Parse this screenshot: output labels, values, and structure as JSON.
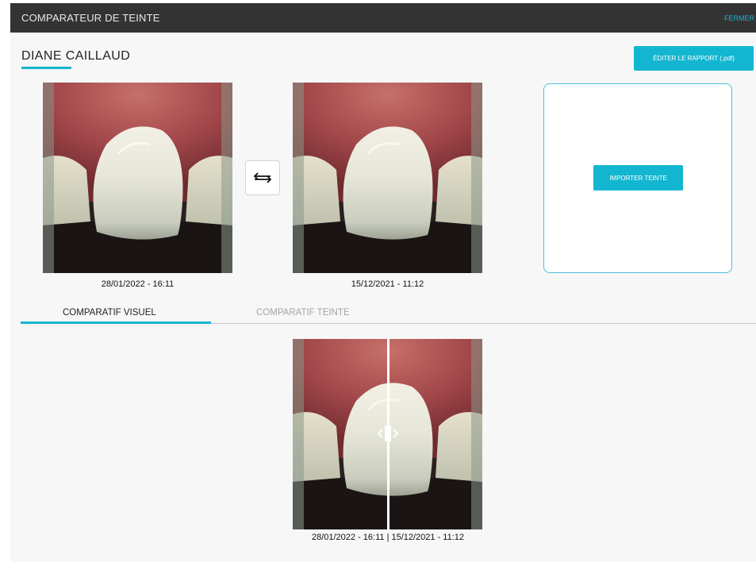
{
  "window": {
    "title": "COMPARATEUR DE TEINTE",
    "close_label": "FERMER"
  },
  "patient": {
    "name": "DIANE CAILLAUD"
  },
  "actions": {
    "report_label": "ÉDITER LE RAPPORT (.pdf)",
    "import_label": "IMPORTER TEINTE"
  },
  "photos": [
    {
      "caption": "28/01/2022 - 16:11"
    },
    {
      "caption": "15/12/2021 - 11:12"
    }
  ],
  "tabs": [
    {
      "label": "COMPARATIF VISUEL",
      "active": true
    },
    {
      "label": "COMPARATIF TEINTE",
      "active": false
    }
  ],
  "comparison": {
    "caption": "28/01/2022 - 16:11 | 15/12/2021 - 11:12",
    "split_position": 0.5
  },
  "colors": {
    "accent": "#13b6d1",
    "titlebar": "#333333",
    "inactive_tab": "#a3a3a3"
  }
}
